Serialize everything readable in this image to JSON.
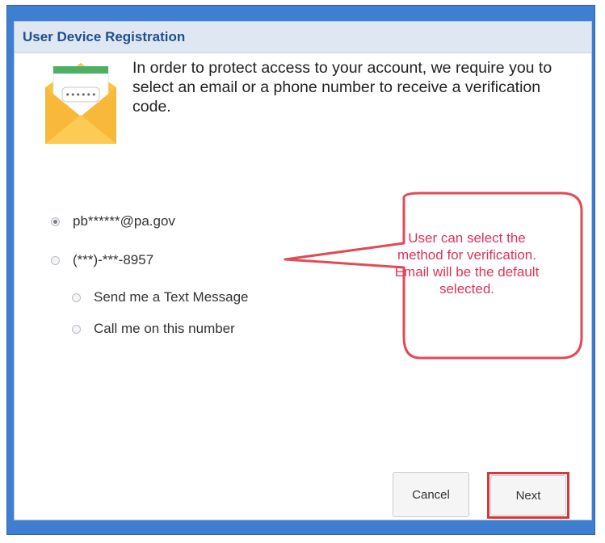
{
  "dialog": {
    "title": "User Device Registration",
    "intro": "In order to protect access to your account, we require you to select an email or a phone number to receive a verification code.",
    "envelope_code": "••••••"
  },
  "options": {
    "email": {
      "label": "pb******@pa.gov",
      "selected": true
    },
    "phone": {
      "label": "(***)-***-8957",
      "selected": false
    },
    "text_message": {
      "label": "Send me a Text Message",
      "selected": false
    },
    "call": {
      "label": "Call me on this number",
      "selected": false
    }
  },
  "callout": {
    "lines": [
      "User can select the",
      "method for verification.",
      "Email will be the default",
      "selected."
    ]
  },
  "buttons": {
    "cancel": "Cancel",
    "next": "Next"
  },
  "colors": {
    "frame": "#3f7fd1",
    "title_text": "#1e4f8f",
    "callout_border": "#e24a56",
    "callout_text": "#e0325a",
    "highlight": "#d9363b",
    "envelope": "#f9c33f",
    "envelope_band": "#4caf62"
  }
}
